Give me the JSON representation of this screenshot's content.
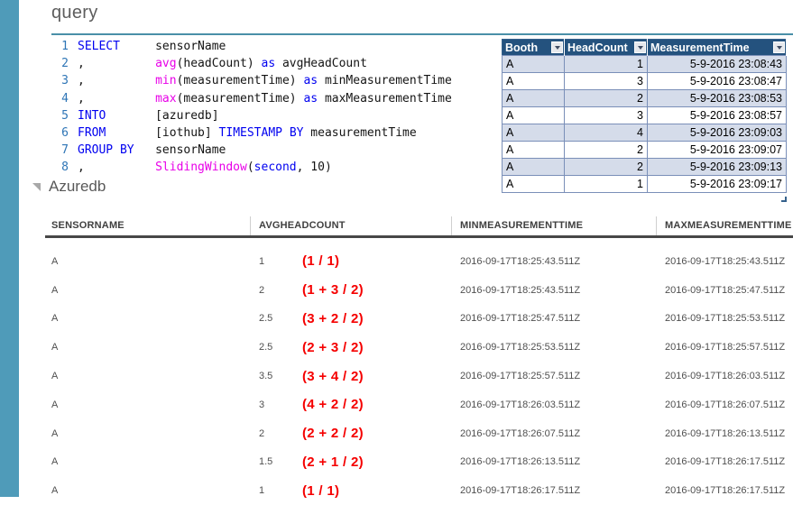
{
  "page": {
    "title": "query"
  },
  "colors": {
    "accent_teal": "#4F9BB9",
    "divider_teal": "#4A90A8",
    "excel_header_bg": "#24527E",
    "excel_alt_row_bg": "#D5DCEA",
    "keyword_blue": "#0000F0",
    "function_magenta": "#E800E8",
    "line_number_blue": "#2E75B6",
    "formula_red": "#F50000"
  },
  "editor": {
    "lines": [
      {
        "num": "1",
        "segments": [
          {
            "text": "SELECT",
            "type": "kw"
          },
          {
            "text": "     sensorName",
            "type": "pl"
          }
        ]
      },
      {
        "num": "2",
        "segments": [
          {
            "text": ",          ",
            "type": "pl"
          },
          {
            "text": "avg",
            "type": "fn"
          },
          {
            "text": "(headCount) ",
            "type": "pl"
          },
          {
            "text": "as",
            "type": "kw"
          },
          {
            "text": " avgHeadCount",
            "type": "pl"
          }
        ]
      },
      {
        "num": "3",
        "segments": [
          {
            "text": ",          ",
            "type": "pl"
          },
          {
            "text": "min",
            "type": "fn"
          },
          {
            "text": "(measurementTime) ",
            "type": "pl"
          },
          {
            "text": "as",
            "type": "kw"
          },
          {
            "text": " minMeasurementTime",
            "type": "pl"
          }
        ]
      },
      {
        "num": "4",
        "segments": [
          {
            "text": ",          ",
            "type": "pl"
          },
          {
            "text": "max",
            "type": "fn"
          },
          {
            "text": "(measurementTime) ",
            "type": "pl"
          },
          {
            "text": "as",
            "type": "kw"
          },
          {
            "text": " maxMeasurementTime",
            "type": "pl"
          }
        ]
      },
      {
        "num": "5",
        "segments": [
          {
            "text": "INTO",
            "type": "kw"
          },
          {
            "text": "       [azuredb]",
            "type": "pl"
          }
        ]
      },
      {
        "num": "6",
        "segments": [
          {
            "text": "FROM",
            "type": "kw"
          },
          {
            "text": "       [iothub] ",
            "type": "pl"
          },
          {
            "text": "TIMESTAMP BY",
            "type": "kw"
          },
          {
            "text": " measurementTime",
            "type": "pl"
          }
        ]
      },
      {
        "num": "7",
        "segments": [
          {
            "text": "GROUP BY",
            "type": "kw"
          },
          {
            "text": "   sensorName",
            "type": "pl"
          }
        ]
      },
      {
        "num": "8",
        "segments": [
          {
            "text": ",          ",
            "type": "pl"
          },
          {
            "text": "SlidingWindow",
            "type": "fn"
          },
          {
            "text": "(",
            "type": "pl"
          },
          {
            "text": "second",
            "type": "kw"
          },
          {
            "text": ", 10)",
            "type": "pl"
          }
        ]
      }
    ]
  },
  "excel_table": {
    "columns": [
      {
        "label": "Booth"
      },
      {
        "label": "HeadCount"
      },
      {
        "label": "MeasurementTime"
      }
    ],
    "rows": [
      [
        "A",
        "1",
        "5-9-2016 23:08:43"
      ],
      [
        "A",
        "3",
        "5-9-2016 23:08:47"
      ],
      [
        "A",
        "2",
        "5-9-2016 23:08:53"
      ],
      [
        "A",
        "3",
        "5-9-2016 23:08:57"
      ],
      [
        "A",
        "4",
        "5-9-2016 23:09:03"
      ],
      [
        "A",
        "2",
        "5-9-2016 23:09:07"
      ],
      [
        "A",
        "2",
        "5-9-2016 23:09:13"
      ],
      [
        "A",
        "1",
        "5-9-2016 23:09:17"
      ]
    ]
  },
  "output": {
    "section_title": "Azuredb",
    "columns": [
      "SENSORNAME",
      "AVGHEADCOUNT",
      "MINMEASUREMENTTIME",
      "MAXMEASUREMENTTIME"
    ],
    "rows": [
      {
        "sensor": "A",
        "avg": "1",
        "formula": "(1 / 1)",
        "min": "2016-09-17T18:25:43.511Z",
        "max": "2016-09-17T18:25:43.511Z"
      },
      {
        "sensor": "A",
        "avg": "2",
        "formula": "(1 + 3 / 2)",
        "min": "2016-09-17T18:25:43.511Z",
        "max": "2016-09-17T18:25:47.511Z"
      },
      {
        "sensor": "A",
        "avg": "2.5",
        "formula": "(3 + 2 / 2)",
        "min": "2016-09-17T18:25:47.511Z",
        "max": "2016-09-17T18:25:53.511Z"
      },
      {
        "sensor": "A",
        "avg": "2.5",
        "formula": "(2 + 3 / 2)",
        "min": "2016-09-17T18:25:53.511Z",
        "max": "2016-09-17T18:25:57.511Z"
      },
      {
        "sensor": "A",
        "avg": "3.5",
        "formula": "(3 + 4 / 2)",
        "min": "2016-09-17T18:25:57.511Z",
        "max": "2016-09-17T18:26:03.511Z"
      },
      {
        "sensor": "A",
        "avg": "3",
        "formula": "(4 + 2 / 2)",
        "min": "2016-09-17T18:26:03.511Z",
        "max": "2016-09-17T18:26:07.511Z"
      },
      {
        "sensor": "A",
        "avg": "2",
        "formula": "(2 + 2 / 2)",
        "min": "2016-09-17T18:26:07.511Z",
        "max": "2016-09-17T18:26:13.511Z"
      },
      {
        "sensor": "A",
        "avg": "1.5",
        "formula": "(2 + 1 / 2)",
        "min": "2016-09-17T18:26:13.511Z",
        "max": "2016-09-17T18:26:17.511Z"
      },
      {
        "sensor": "A",
        "avg": "1",
        "formula": "(1 / 1)",
        "min": "2016-09-17T18:26:17.511Z",
        "max": "2016-09-17T18:26:17.511Z"
      }
    ]
  }
}
